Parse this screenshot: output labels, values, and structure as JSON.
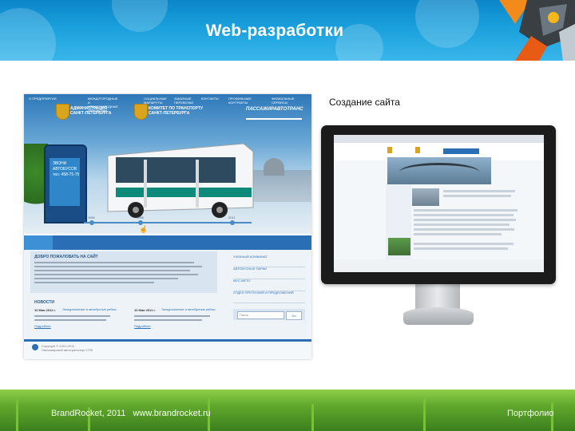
{
  "slide": {
    "title": "Web-разработки",
    "caption": "Создание сайта",
    "footer_left": "BrandRocket, 2011",
    "footer_url": "www.brandrocket.ru",
    "footer_right": "Портфолио"
  },
  "colors": {
    "header_blue": "#1aa0dc",
    "site_nav_blue": "#2a6fb5",
    "grass_green": "#5fa82c"
  },
  "site": {
    "header_admin": "АДМИНИСТРАЦИЯ\nСАНКТ-ПЕТЕРБУРГА",
    "header_committee": "КОМИТЕТ ПО ТРАНСПОРТУ\nСАНКТ-ПЕТЕРБУРГА",
    "logo": "ПАССАЖИРАВТОТРАНС",
    "shelter_text": "ЗВОНИ\nАВТОБУСОВ\nтел. 458-75-75",
    "welcome_title": "ДОБРО ПОЖАЛОВАТЬ НА САЙТ",
    "news_title": "НОВОСТИ",
    "news": [
      {
        "date": "10 Мая 2011 г.",
        "link": "Экскурсионные и автобусные рейсы",
        "more": "Подробнее"
      },
      {
        "date": "10 Мая 2011 г.",
        "link": "Экскурсионные и автобусные рейсы",
        "more": "Подробнее"
      }
    ],
    "nav": [
      "О ПРЕДПРИЯТИИ",
      "МЕЖДУГОРОДНЫЕ И МЕЖДУНАРОДНЫЕ ПЕРЕВОЗКИ",
      "СОЦИАЛЬНЫЕ МАРШРУТЫ",
      "ЗАКАЗНЫЕ ПЕРЕВОЗКИ",
      "КОНТАКТЫ",
      "ПРОФИЛЬНЫЕ КОНТРАКТЫ",
      "ФИЛИАЛЬНЫЕ СЕРВИСЫ"
    ],
    "side_menu": [
      "УЧЕБНЫЙ КОМБИНАТ",
      "АВТОБУСНЫЕ ПАРКИ",
      "МУС-МЕТО",
      "ОТДЕЛ ПРЕТЕНЗИЙ И ПРЕДЛОЖЕНИЙ"
    ],
    "search_placeholder": "Поиск",
    "search_button": "Go",
    "timeline_labels": [
      "1960",
      "1985",
      "2011"
    ],
    "footer_text": "Copyright © 2001-2011\nПассажирский автотранспорт СПб"
  }
}
